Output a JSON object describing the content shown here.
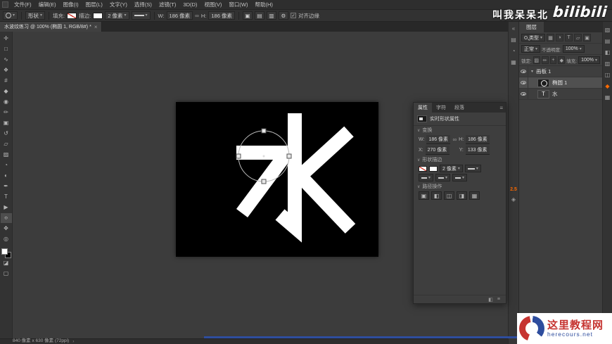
{
  "app": {
    "menu": [
      "文件(F)",
      "编辑(E)",
      "图像(I)",
      "图层(L)",
      "文字(Y)",
      "选择(S)",
      "滤镜(T)",
      "3D(D)",
      "视图(V)",
      "窗口(W)",
      "帮助(H)"
    ]
  },
  "icons": {
    "caret": "▾",
    "section": "∨",
    "close": "×",
    "panel_menu": "≡",
    "gear": "⚙",
    "link": "∞",
    "check": "✓",
    "chevron_right": "›",
    "clip": "◧",
    "list": "≡"
  },
  "options_bar": {
    "mode": "形状",
    "fill_label": "填充:",
    "stroke_label": "描边:",
    "stroke_width": "2 像素",
    "w_label": "W:",
    "w_value": "186 像素",
    "h_label": "H:",
    "h_value": "186 像素",
    "align_edges": "对齐边缘",
    "op_icons": [
      {
        "name": "path-operations-icon",
        "glyph": "▣"
      },
      {
        "name": "path-alignment-icon",
        "glyph": "▤"
      },
      {
        "name": "path-arrangement-icon",
        "glyph": "▥"
      }
    ]
  },
  "document": {
    "tab_title": "水波纹练习 @ 100% (椭圆 1, RGB/8#) *",
    "canvas_glyph": "水",
    "status": "840 像素 x 630 像素 (72ppi)"
  },
  "toolbar": {
    "tools": [
      {
        "name": "move-tool",
        "glyph": "✛"
      },
      {
        "name": "marquee-tool",
        "glyph": "□"
      },
      {
        "name": "lasso-tool",
        "glyph": "∿"
      },
      {
        "name": "quick-selection-tool",
        "glyph": "❖"
      },
      {
        "name": "crop-tool",
        "glyph": "#"
      },
      {
        "name": "eyedropper-tool",
        "glyph": "◆"
      },
      {
        "name": "healing-brush-tool",
        "glyph": "◉"
      },
      {
        "name": "brush-tool",
        "glyph": "✏"
      },
      {
        "name": "clone-stamp-tool",
        "glyph": "▣"
      },
      {
        "name": "history-brush-tool",
        "glyph": "↺"
      },
      {
        "name": "eraser-tool",
        "glyph": "▱"
      },
      {
        "name": "gradient-tool",
        "glyph": "▨"
      },
      {
        "name": "blur-tool",
        "glyph": "◔"
      },
      {
        "name": "dodge-tool",
        "glyph": "◐"
      },
      {
        "name": "pen-tool",
        "glyph": "✒"
      },
      {
        "name": "type-tool",
        "glyph": "T"
      },
      {
        "name": "path-selection-tool",
        "glyph": "▶"
      },
      {
        "name": "shape-tool",
        "glyph": "○",
        "active": true
      },
      {
        "name": "hand-tool",
        "glyph": "✥"
      },
      {
        "name": "zoom-tool",
        "glyph": "◎"
      }
    ],
    "bottom": [
      {
        "name": "quick-mask-mode-icon",
        "glyph": "◪"
      },
      {
        "name": "screen-mode-icon",
        "glyph": "▢"
      }
    ]
  },
  "properties": {
    "tabs": [
      "属性",
      "字符",
      "段落"
    ],
    "title": "实时形状属性",
    "transform_label": "变换",
    "w_label": "W:",
    "w_value": "186 像素",
    "h_label": "H:",
    "h_value": "186 像素",
    "x_label": "X:",
    "x_value": "270 像素",
    "y_label": "Y:",
    "y_value": "133 像素",
    "stroke_label": "形状描边",
    "stroke_width": "2 像素",
    "path_ops_label": "路径操作",
    "path_ops_icons": [
      {
        "name": "combine-shapes-icon",
        "glyph": "▣"
      },
      {
        "name": "subtract-front-shape-icon",
        "glyph": "◧"
      },
      {
        "name": "intersect-shapes-icon",
        "glyph": "◫"
      },
      {
        "name": "exclude-overlapping-icon",
        "glyph": "◨"
      },
      {
        "name": "merge-shape-components-icon",
        "glyph": "▦"
      }
    ]
  },
  "layers": {
    "tab": "图层",
    "filter_label": "类型",
    "blend_mode": "正常",
    "opacity_label": "不透明度:",
    "opacity_value": "100%",
    "lock_label": "锁定:",
    "fill_label": "填充:",
    "fill_value": "100%",
    "text_thumb": "T",
    "filter_icons": [
      {
        "name": "filter-pixel-layers-icon",
        "glyph": "▦"
      },
      {
        "name": "filter-adjustment-layers-icon",
        "glyph": "◑"
      },
      {
        "name": "filter-type-layers-icon",
        "glyph": "T"
      },
      {
        "name": "filter-shape-layers-icon",
        "glyph": "▱"
      },
      {
        "name": "filter-smart-objects-icon",
        "glyph": "▣"
      }
    ],
    "lock_icons": [
      {
        "name": "lock-transparent-pixels-icon",
        "glyph": "▨"
      },
      {
        "name": "lock-image-pixels-icon",
        "glyph": "✏"
      },
      {
        "name": "lock-position-icon",
        "glyph": "+"
      },
      {
        "name": "lock-all-icon",
        "glyph": "◆"
      }
    ],
    "items": [
      {
        "name": "画板 1"
      },
      {
        "name": "椭圆 1"
      },
      {
        "name": "水"
      }
    ],
    "bottom_icons": [
      {
        "name": "link-layers-icon",
        "glyph": "∞"
      },
      {
        "name": "layer-style-icon",
        "glyph": "fx"
      },
      {
        "name": "layer-mask-icon",
        "glyph": "◨"
      },
      {
        "name": "adjustment-layer-icon",
        "glyph": "◑"
      },
      {
        "name": "layer-group-icon",
        "glyph": "▭"
      },
      {
        "name": "new-layer-icon",
        "glyph": "⊞"
      },
      {
        "name": "delete-layer-icon",
        "glyph": "⌦"
      }
    ]
  },
  "rightdock": {
    "badge": "2.5",
    "col_a_icons": [
      {
        "name": "collapse-panels-icon",
        "glyph": "«"
      },
      {
        "name": "color-panel-icon",
        "glyph": "▤"
      },
      {
        "name": "adjustments-panel-icon",
        "glyph": "◔"
      },
      {
        "name": "libraries-panel-icon",
        "glyph": "▦"
      }
    ],
    "col_a_after": [
      {
        "name": "info-panel-icon",
        "glyph": "◈"
      }
    ],
    "col_c_icons": [
      {
        "name": "history-panel-icon",
        "glyph": "▧"
      },
      {
        "name": "swatches-panel-icon",
        "glyph": "▤"
      },
      {
        "name": "styles-panel-icon",
        "glyph": "◧"
      },
      {
        "name": "channels-panel-icon",
        "glyph": "▥"
      },
      {
        "name": "paths-panel-icon",
        "glyph": "◫"
      },
      {
        "name": "sync-panel-icon",
        "glyph": "◆",
        "active": true
      },
      {
        "name": "notes-panel-icon",
        "glyph": "▦"
      }
    ]
  },
  "overlays": {
    "author": "叫我呆呆北",
    "brand": "bilibili"
  },
  "watermark": {
    "site_name": "这里教程网",
    "site_url": "herecours.net"
  },
  "colors": {
    "no_fill_slash_red": "#d23a2e",
    "watermark_red": "#c63431",
    "watermark_blue": "#2e4d9e",
    "badge_orange": "#ff6a00"
  }
}
